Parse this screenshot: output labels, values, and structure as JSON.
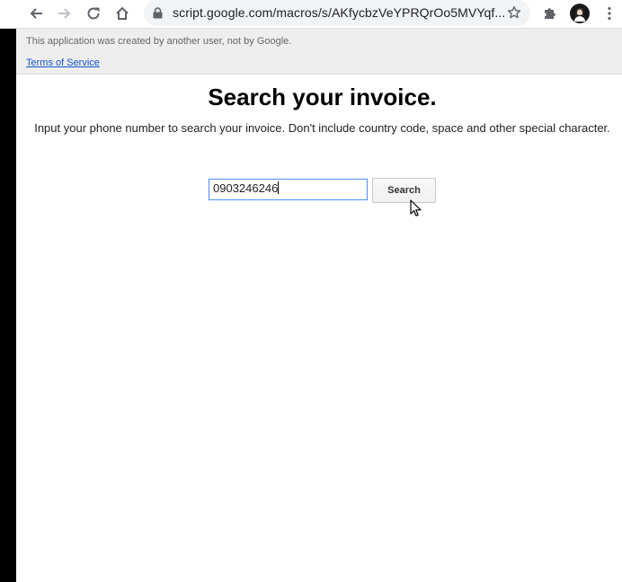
{
  "browser": {
    "url_display": "script.google.com/macros/s/AKfycbzVeYPRQrOo5MVYqf...",
    "icons": [
      "back-arrow-icon",
      "forward-arrow-icon",
      "reload-icon",
      "home-icon",
      "lock-icon",
      "bookmark-star-icon",
      "extensions-puzzle-icon",
      "profile-avatar",
      "kebab-menu-icon"
    ]
  },
  "banner": {
    "notice": "This application was created by another user, not by Google.",
    "terms_link": "Terms of Service"
  },
  "page": {
    "title": "Search your invoice.",
    "instruction": "Input your phone number to search your invoice. Don't include country code, space and other special character.",
    "phone_value": "0903246246",
    "search_label": "Search"
  },
  "colors": {
    "banner_bg": "#eeeeee",
    "link": "#1155cc",
    "input_focus_border": "#4d90fe",
    "omnibox_bg": "#f1f3f4"
  }
}
